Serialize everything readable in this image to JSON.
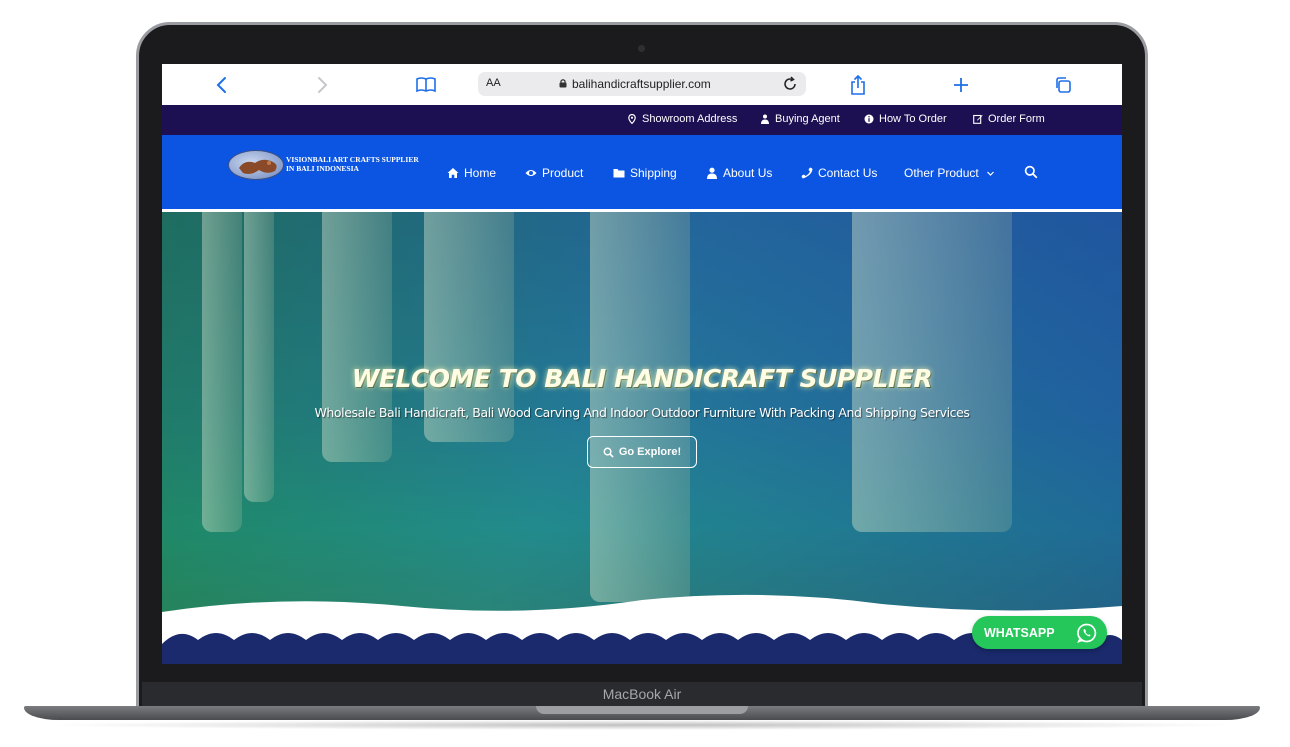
{
  "device": {
    "label": "MacBook Air"
  },
  "browser": {
    "address_prefix": "AA",
    "url": "balihandicraftsupplier.com"
  },
  "topbar": {
    "items": [
      {
        "label": "Showroom Address",
        "icon": "map-pin-icon"
      },
      {
        "label": "Buying Agent",
        "icon": "users-icon"
      },
      {
        "label": "How To Order",
        "icon": "info-icon"
      },
      {
        "label": "Order Form",
        "icon": "edit-icon"
      }
    ]
  },
  "logo": {
    "line1": "VISIONBALI ART CRAFTS SUPPLIER",
    "line2": "IN BALI INDONESIA"
  },
  "nav": {
    "items": [
      {
        "label": "Home",
        "icon": "home-icon"
      },
      {
        "label": "Product",
        "icon": "eye-icon"
      },
      {
        "label": "Shipping",
        "icon": "folder-icon"
      },
      {
        "label": "About Us",
        "icon": "user-icon"
      },
      {
        "label": "Contact Us",
        "icon": "phone-icon"
      },
      {
        "label": "Other Product",
        "icon": "chevron-down-icon"
      }
    ],
    "search_icon": "search-icon"
  },
  "hero": {
    "title": "WELCOME TO BALI HANDICRAFT SUPPLIER",
    "subtitle": "Wholesale Bali Handicraft, Bali Wood Carving And Indoor Outdoor Furniture With Packing And Shipping Services",
    "button_label": "Go Explore!"
  },
  "whatsapp": {
    "label": "WHATSAPP"
  },
  "colors": {
    "topbar_bg": "#1c0f52",
    "nav_bg": "#0c55e2",
    "whatsapp_green": "#25c65a",
    "wave_navy": "#1a2a6c"
  }
}
